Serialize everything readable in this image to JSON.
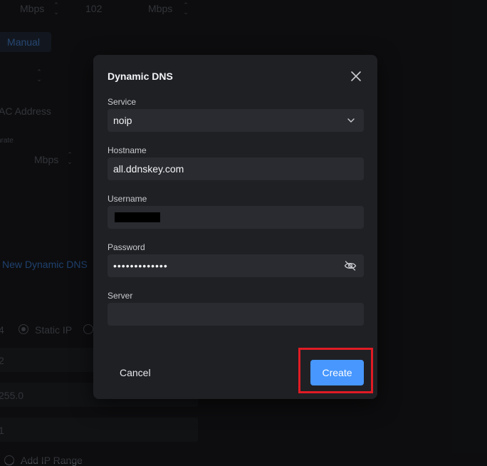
{
  "background": {
    "rate_left_unit": "Mbps",
    "rate_value": "102",
    "rate_right_unit": "Mbps",
    "manual_button": "Manual",
    "mac_address": "AC Address",
    "rate_label": "nrate",
    "rate_unit2": "Mbps",
    "new_ddns_link": "New Dynamic DNS",
    "ipv4_label": "4",
    "static_ip": "Static IP",
    "value_1": "2",
    "value_2": "255.0",
    "value_3": "1",
    "add_ip_range": "Add IP Range"
  },
  "modal": {
    "title": "Dynamic DNS",
    "service_label": "Service",
    "service_value": "noip",
    "hostname_label": "Hostname",
    "hostname_value": "all.ddnskey.com",
    "username_label": "Username",
    "password_label": "Password",
    "password_value": "•••••••••••••",
    "server_label": "Server",
    "server_value": "",
    "cancel_label": "Cancel",
    "create_label": "Create"
  },
  "icons": {
    "close": "close-icon",
    "service_dropdown": "chevron-down-icon",
    "password_toggle": "eye-off-icon"
  },
  "colors": {
    "accent": "#4797ff",
    "highlight": "#e01b24",
    "modal_bg": "#1f2024",
    "field_bg": "#2a2b30"
  }
}
